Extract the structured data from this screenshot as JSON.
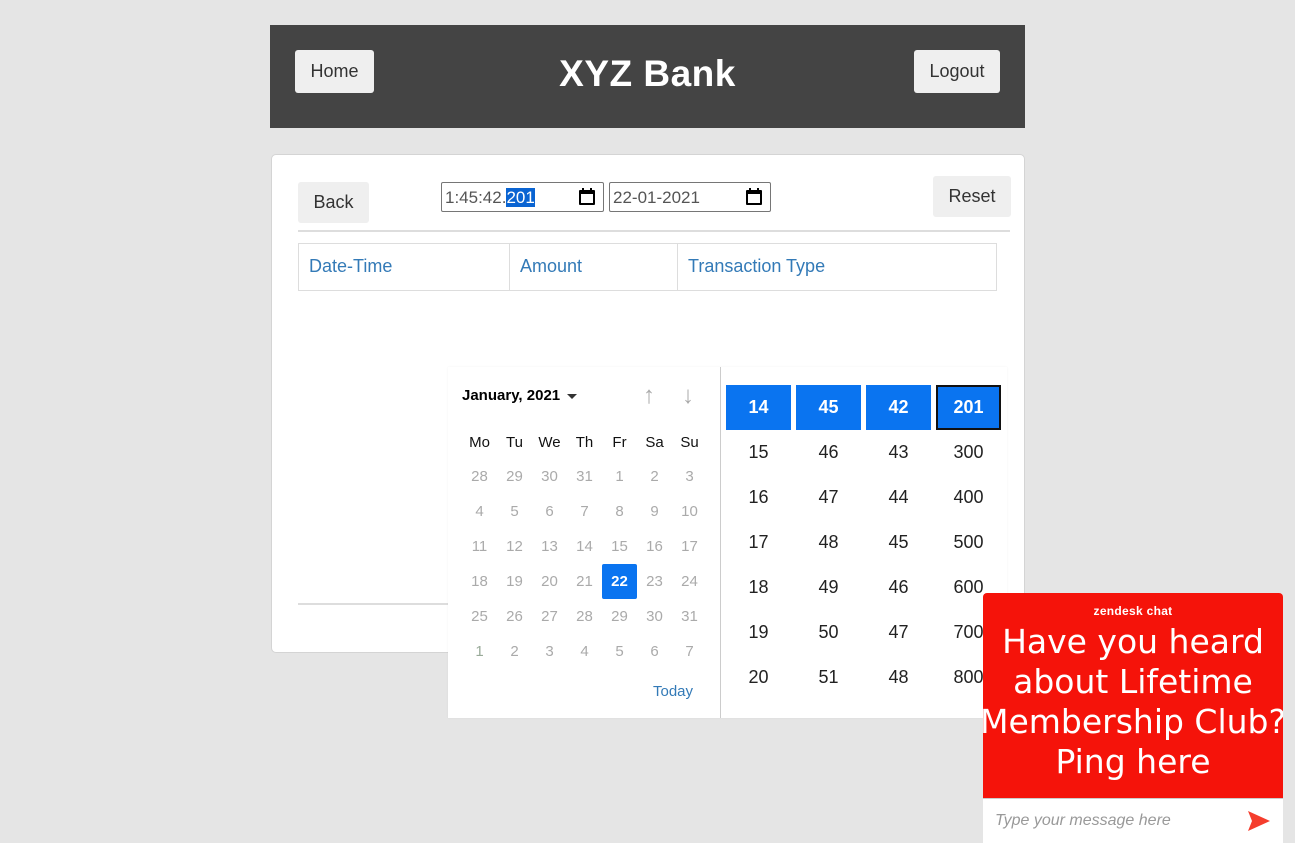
{
  "header": {
    "brand": "XYZ Bank",
    "home_label": "Home",
    "logout_label": "Logout",
    "bg_color": "#444444"
  },
  "toolbar": {
    "back_label": "Back",
    "reset_label": "Reset",
    "time_input": {
      "prefix": "1:45:42.",
      "selected": "201"
    },
    "date_input": {
      "value": "22-01-2021"
    }
  },
  "table": {
    "columns": [
      "Date-Time",
      "Amount",
      "Transaction Type"
    ]
  },
  "picker": {
    "month_label": "January, 2021",
    "weekdays": [
      "Mo",
      "Tu",
      "We",
      "Th",
      "Fr",
      "Sa",
      "Su"
    ],
    "weeks": [
      [
        "28",
        "29",
        "30",
        "31",
        "1",
        "2",
        "3"
      ],
      [
        "4",
        "5",
        "6",
        "7",
        "8",
        "9",
        "10"
      ],
      [
        "11",
        "12",
        "13",
        "14",
        "15",
        "16",
        "17"
      ],
      [
        "18",
        "19",
        "20",
        "21",
        "22",
        "23",
        "24"
      ],
      [
        "25",
        "26",
        "27",
        "28",
        "29",
        "30",
        "31"
      ],
      [
        "1",
        "2",
        "3",
        "4",
        "5",
        "6",
        "7"
      ]
    ],
    "selected_day": "22",
    "today_label": "Today",
    "time_columns": [
      [
        "14",
        "15",
        "16",
        "17",
        "18",
        "19",
        "20"
      ],
      [
        "45",
        "46",
        "47",
        "48",
        "49",
        "50",
        "51"
      ],
      [
        "42",
        "43",
        "44",
        "45",
        "46",
        "47",
        "48"
      ],
      [
        "201",
        "300",
        "400",
        "500",
        "600",
        "700",
        "800"
      ]
    ],
    "accent_color": "#0a74f0"
  },
  "chat": {
    "brand": "zendesk chat",
    "message": "Have you heard about Lifetime Membership Club? Ping here",
    "input_placeholder": "Type your message here",
    "color": "#f5130a"
  }
}
